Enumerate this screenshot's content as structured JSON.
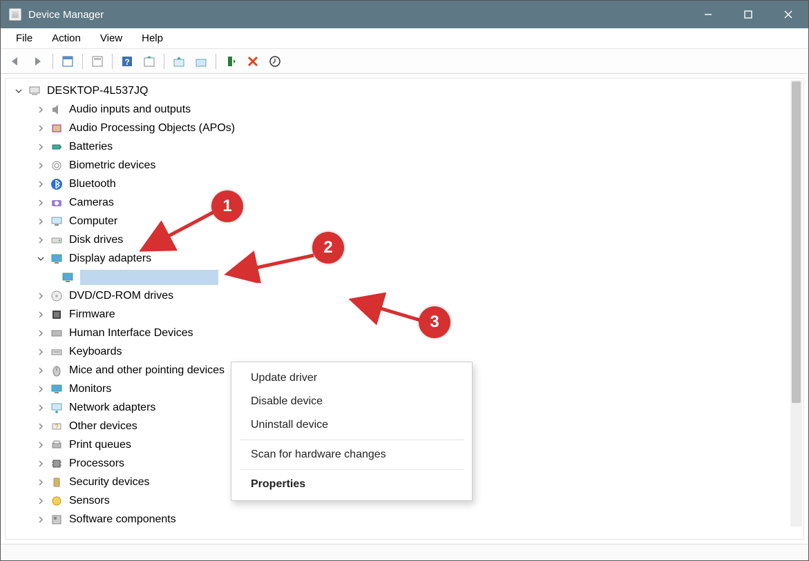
{
  "window": {
    "title": "Device Manager"
  },
  "menubar": {
    "items": [
      "File",
      "Action",
      "View",
      "Help"
    ]
  },
  "toolbar": {
    "back": "Back",
    "forward": "Forward",
    "show_hidden": "Show hidden devices",
    "properties": "Properties",
    "help": "Help",
    "refresh": "Scan for hardware changes",
    "update": "Update driver",
    "uninstall": "Uninstall device",
    "disable": "Disable device",
    "enable": "Enable device"
  },
  "tree": {
    "root": "DESKTOP-4L537JQ",
    "categories": [
      "Audio inputs and outputs",
      "Audio Processing Objects (APOs)",
      "Batteries",
      "Biometric devices",
      "Bluetooth",
      "Cameras",
      "Computer",
      "Disk drives",
      "Display adapters",
      "DVD/CD-ROM drives",
      "Firmware",
      "Human Interface Devices",
      "Keyboards",
      "Mice and other pointing devices",
      "Monitors",
      "Network adapters",
      "Other devices",
      "Print queues",
      "Processors",
      "Security devices",
      "Sensors",
      "Software components"
    ],
    "expanded_category_index": 8,
    "selected_device_label": ""
  },
  "context_menu": {
    "items": [
      "Update driver",
      "Disable device",
      "Uninstall device",
      "Scan for hardware changes",
      "Properties"
    ]
  },
  "callouts": {
    "1": "1",
    "2": "2",
    "3": "3"
  },
  "colors": {
    "titlebar": "#5f7885",
    "callout": "#d63030",
    "selection": "#bfd8ee"
  }
}
